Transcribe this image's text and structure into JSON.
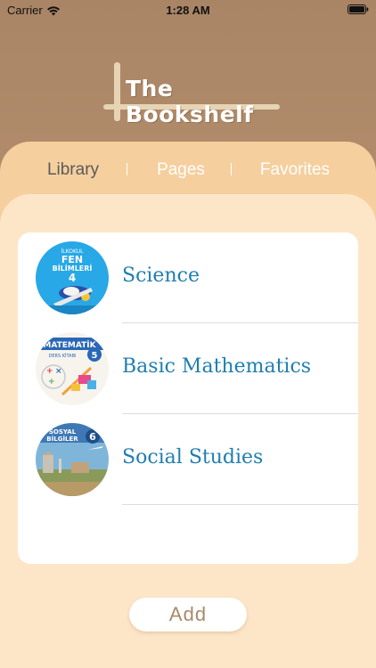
{
  "status_bar": {
    "carrier": "Carrier",
    "time": "1:28 AM"
  },
  "app": {
    "title": "The Bookshelf"
  },
  "tabs": [
    {
      "label": "Library",
      "active": true
    },
    {
      "label": "Pages",
      "active": false
    },
    {
      "label": "Favorites",
      "active": false
    }
  ],
  "books": [
    {
      "title": "Science",
      "cover_icon": "science-book-cover-icon"
    },
    {
      "title": "Basic Mathematics",
      "cover_icon": "mathematics-book-cover-icon"
    },
    {
      "title": "Social Studies",
      "cover_icon": "social-studies-book-cover-icon"
    }
  ],
  "add_button": {
    "label": "Add"
  },
  "colors": {
    "header_brown": "#b48e6c",
    "panel_tan": "#f5cf9e",
    "content_cream": "#fde6c8",
    "title_blue": "#1f7eb0",
    "add_text": "#a88a6a"
  }
}
